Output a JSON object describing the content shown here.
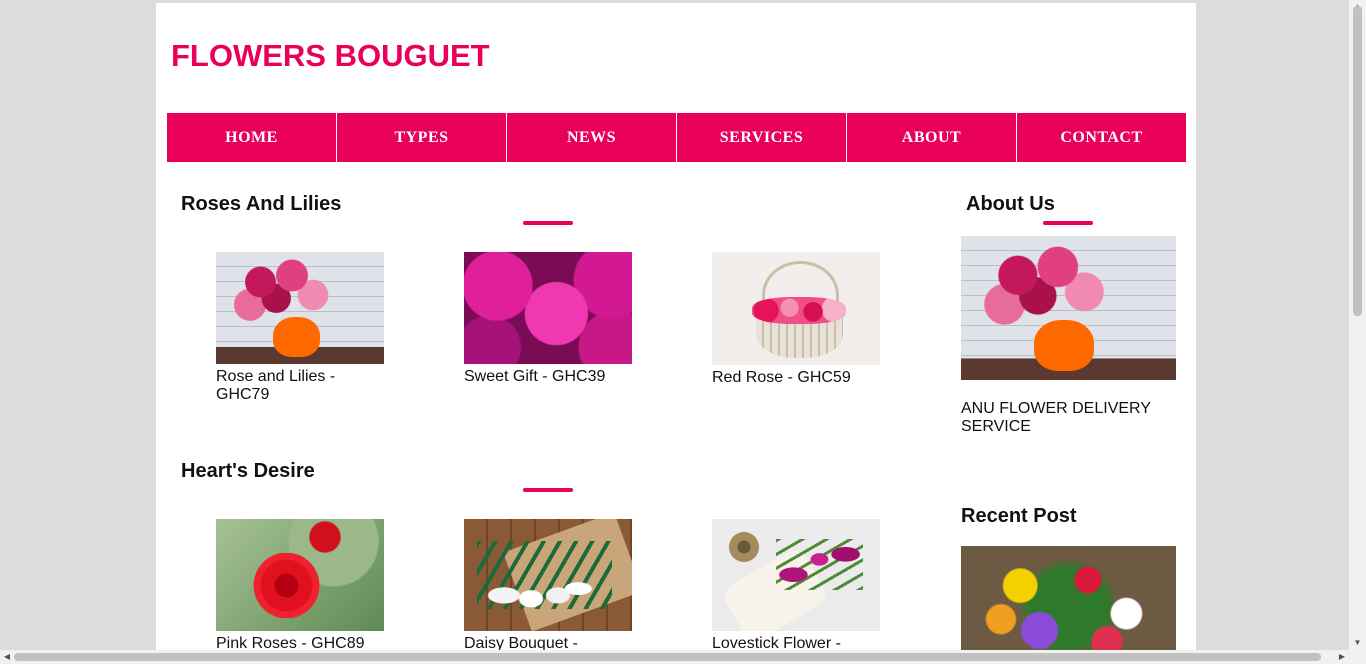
{
  "site": {
    "title": "FLOWERS BOUGUET"
  },
  "nav": [
    "HOME",
    "TYPES",
    "NEWS",
    "SERVICES",
    "ABOUT",
    "CONTACT"
  ],
  "sections": [
    {
      "title": "Roses And Lilies",
      "products": [
        {
          "name": "Rose and Lilies - GHC79",
          "image": "pink-bouquet-orange-vase"
        },
        {
          "name": "Sweet Gift - GHC39",
          "image": "pink-dahlias"
        },
        {
          "name": "Red Rose - GHC59",
          "image": "rose-basket"
        }
      ]
    },
    {
      "title": "Heart's Desire",
      "products": [
        {
          "name": "Pink Roses - GHC89",
          "image": "red-rose"
        },
        {
          "name": "Daisy Bouquet -",
          "image": "white-tulips"
        },
        {
          "name": "Lovestick Flower -",
          "image": "purple-tulips"
        }
      ]
    }
  ],
  "sidebar": {
    "about_title": "About Us",
    "about_text": "ANU FLOWER DELIVERY SERVICE",
    "recent_title": "Recent Post"
  },
  "colors": {
    "accent": "#e8005a",
    "page_bg": "#dcdcdc"
  }
}
